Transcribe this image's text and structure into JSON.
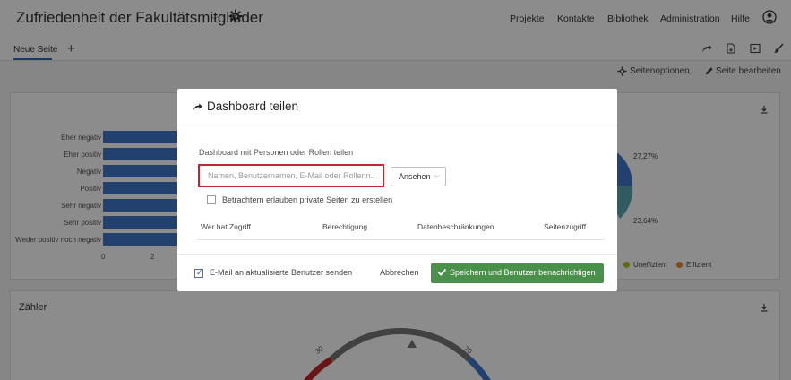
{
  "header": {
    "title": "Zufriedenheit der Fakultätsmitglieder",
    "nav": [
      "Projekte",
      "Kontakte",
      "Bibliothek",
      "Administration",
      "Hilfe"
    ]
  },
  "tabs": {
    "active": "Neue Seite",
    "add": "+"
  },
  "page_options": {
    "options_label": "Seitenoptionen",
    "edit_label": "Seite bearbeiten"
  },
  "card1": {
    "bar_categories": [
      "Eher negativ",
      "Eher positiv",
      "Negativ",
      "Positiv",
      "Sehr negativ",
      "Sehr positiv",
      "Weder positiv noch negativ"
    ],
    "ticks": [
      "0",
      "2"
    ],
    "pie_labels": [
      "27,27%",
      "23,64%"
    ],
    "legend": [
      {
        "label": "Uneffizient",
        "color": "#b5bf2e"
      },
      {
        "label": "Effizient",
        "color": "#e38a32"
      }
    ]
  },
  "card2": {
    "title": "Zähler",
    "gauge_labels": [
      "30",
      "70"
    ]
  },
  "modal": {
    "title": "Dashboard teilen",
    "share_label": "Dashboard mit Personen oder Rollen teilen",
    "search_placeholder": "Namen, Benutzernamen, E-Mail oder Rollenn...",
    "role_value": "Ansehen",
    "private_pages_label": "Betrachtern erlauben private Seiten zu erstellen",
    "columns": [
      "Wer hat Zugriff",
      "Berechtigung",
      "Datenbeschränkungen",
      "Seitenzugriff"
    ],
    "email_label": "E-Mail an aktualisierte Benutzer senden",
    "cancel_label": "Abbrechen",
    "save_label": "Speichern und Benutzer benachrichtigen"
  },
  "colors": {
    "bar": "#3f77c9",
    "highlight": "#c0272d",
    "primary_button": "#4a8f4a"
  }
}
